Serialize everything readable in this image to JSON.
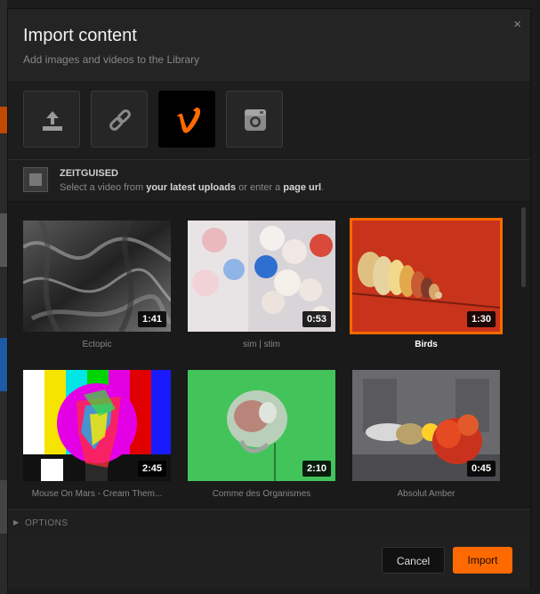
{
  "dialog": {
    "title": "Import content",
    "subtitle": "Add images and videos to the Library",
    "close_glyph": "×"
  },
  "sources": [
    {
      "name": "upload-icon",
      "active": false
    },
    {
      "name": "link-icon",
      "active": false
    },
    {
      "name": "vimeo-icon",
      "active": true
    },
    {
      "name": "instagram-icon",
      "active": false
    }
  ],
  "account": {
    "name": "ZEITGUISED",
    "hint_prefix": "Select a video from ",
    "hint_bold1": "your latest uploads",
    "hint_mid": " or enter a ",
    "hint_bold2": "page url",
    "hint_suffix": "."
  },
  "videos": [
    {
      "title": "Ectopic",
      "duration": "1:41",
      "selected": false
    },
    {
      "title": "sim | stim",
      "duration": "0:53",
      "selected": false
    },
    {
      "title": "Birds",
      "duration": "1:30",
      "selected": true
    },
    {
      "title": "Mouse On Mars - Cream Them...",
      "duration": "2:45",
      "selected": false
    },
    {
      "title": "Comme des Organismes",
      "duration": "2:10",
      "selected": false
    },
    {
      "title": "Absolut Amber",
      "duration": "0:45",
      "selected": false
    }
  ],
  "options": {
    "label": "OPTIONS",
    "toggle_glyph": "▶"
  },
  "footer": {
    "cancel_label": "Cancel",
    "import_label": "Import"
  },
  "colors": {
    "accent": "#ff6a00",
    "vimeo": "#ff6a00"
  }
}
